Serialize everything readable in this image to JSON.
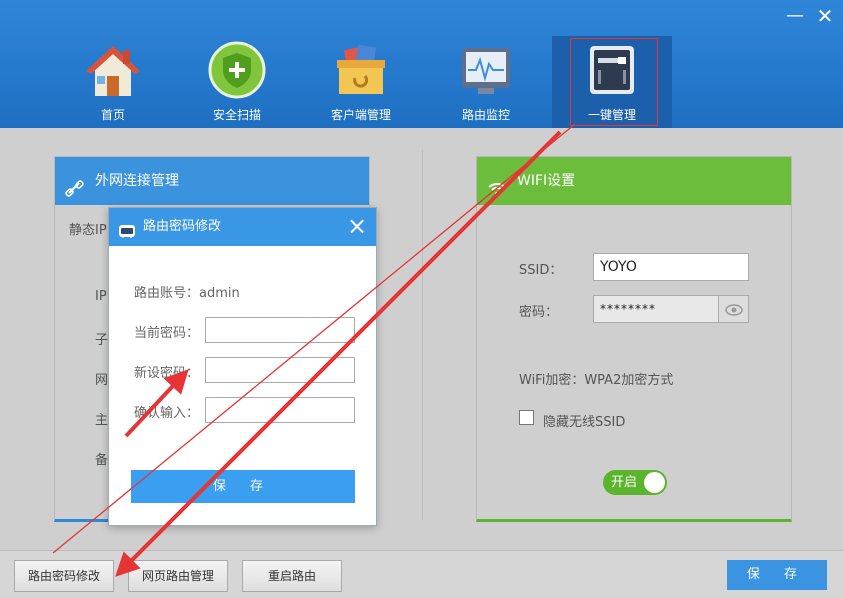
{
  "window": {
    "minimize_glyph": "—",
    "close_glyph": "✕"
  },
  "nav": {
    "items": [
      {
        "label": "首页",
        "icon": "house-icon"
      },
      {
        "label": "安全扫描",
        "icon": "shield-icon"
      },
      {
        "label": "客户端管理",
        "icon": "box-icon"
      },
      {
        "label": "路由监控",
        "icon": "monitor-icon"
      },
      {
        "label": "一键管理",
        "icon": "router-icon",
        "active": true
      }
    ]
  },
  "left_panel": {
    "title": "外网连接管理",
    "rows": [
      "静态IP",
      "IP",
      "子",
      "网",
      "主",
      "备"
    ]
  },
  "right_panel": {
    "title": "WIFI设置",
    "ssid_label": "SSID：",
    "ssid_value": "YOYO",
    "password_label": "密码：",
    "password_value": "********",
    "encryption_text": "WiFi加密：WPA2加密方式",
    "hide_ssid_label": "隐藏无线SSID",
    "toggle_label": "开启"
  },
  "dialog": {
    "title": "路由密码修改",
    "account_text": "路由账号：admin",
    "current_password_label": "当前密码：",
    "new_password_label": "新设密码：",
    "confirm_label": "确认输入：",
    "save_label": "保 存"
  },
  "footer": {
    "change_password_label": "路由密码修改",
    "web_manage_label": "网页路由管理",
    "reboot_label": "重启路由",
    "save_label": "保 存"
  },
  "colors": {
    "header_blue": "#1e6fc2",
    "panel_blue": "#3a93dc",
    "panel_green": "#6bbd3b",
    "toggle_green": "#5ab52c",
    "annotation_red": "#e53535"
  }
}
